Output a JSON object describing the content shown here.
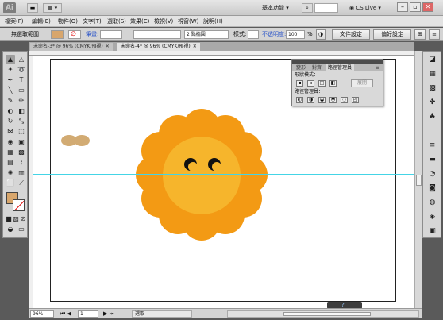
{
  "app": {
    "logo": "Ai",
    "workspace": "基本功能",
    "cs_live": "CS Live",
    "window_controls": [
      "minimize",
      "maximize",
      "close"
    ]
  },
  "menu": [
    "檔案(F)",
    "編輯(E)",
    "物件(O)",
    "文字(T)",
    "選取(S)",
    "效果(C)",
    "檢視(V)",
    "視窗(W)",
    "說明(H)"
  ],
  "control": {
    "selection_label": "無選取範圍",
    "stroke_label": "筆畫:",
    "stroke_weight": "2 點橢圓",
    "style_label": "樣式:",
    "opacity_label": "不透明度:",
    "opacity_value": "100",
    "opacity_unit": "%",
    "doc_setup_button": "文件設定",
    "preferences_button": "偏好設定"
  },
  "tabs": [
    {
      "label": "未命名-3* @ 96% (CMYK/預視)",
      "active": false
    },
    {
      "label": "未命名-4* @ 96% (CMYK/預視)",
      "active": true
    }
  ],
  "pathfinder_panel": {
    "tabs": [
      "變形",
      "對齊",
      "路徑管理員"
    ],
    "active_tab": "路徑管理員",
    "shape_modes_label": "形狀模式：",
    "pathfinders_label": "路徑管理員：",
    "expand_button": "展開"
  },
  "status": {
    "zoom": "96%",
    "page": "1",
    "status_label": "選取"
  },
  "colors": {
    "flower_petals": "#f39a14",
    "flower_center": "#f6b52c",
    "fill_swatch": "#d8a66c",
    "bean": "#d2ab73",
    "guide": "#44d4e6"
  }
}
